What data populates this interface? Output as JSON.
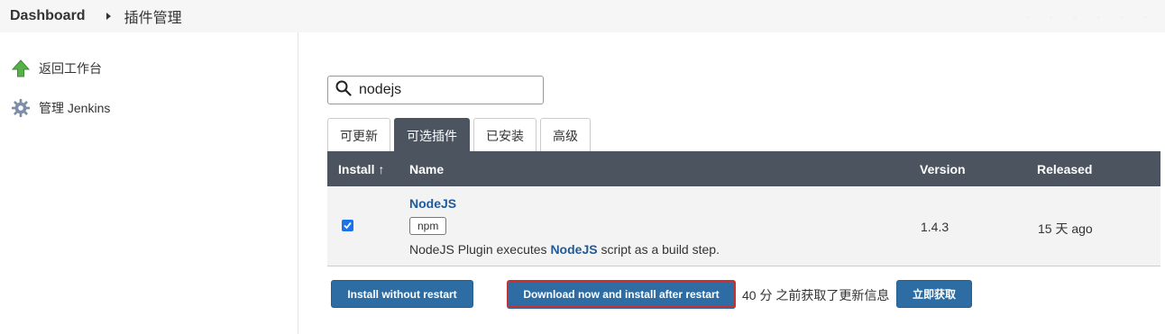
{
  "breadcrumb": {
    "root": "Dashboard",
    "current": "插件管理"
  },
  "sidebar": {
    "items": [
      {
        "label": "返回工作台",
        "icon": "up-arrow-icon"
      },
      {
        "label": "管理 Jenkins",
        "icon": "gear-icon"
      }
    ]
  },
  "search": {
    "value": "nodejs",
    "placeholder": ""
  },
  "tabs": [
    {
      "label": "可更新",
      "active": false
    },
    {
      "label": "可选插件",
      "active": true
    },
    {
      "label": "已安装",
      "active": false
    },
    {
      "label": "高级",
      "active": false
    }
  ],
  "table": {
    "headers": {
      "install": "Install ↑",
      "name": "Name",
      "version": "Version",
      "released": "Released"
    },
    "rows": [
      {
        "checked": true,
        "name": "NodeJS",
        "tag": "npm",
        "desc_prefix": "NodeJS Plugin executes ",
        "desc_link": "NodeJS",
        "desc_suffix": " script as a build step.",
        "version": "1.4.3",
        "released": "15 天 ago"
      }
    ]
  },
  "actions": {
    "install_without_restart": "Install without restart",
    "download_install_after_restart": "Download now and install after restart",
    "update_info": "40 分 之前获取了更新信息",
    "check_now": "立即获取"
  },
  "colors": {
    "header_bg": "#4b545f",
    "button_bg": "#2e6da4",
    "link": "#1f5b99",
    "highlight": "#c8312f"
  }
}
